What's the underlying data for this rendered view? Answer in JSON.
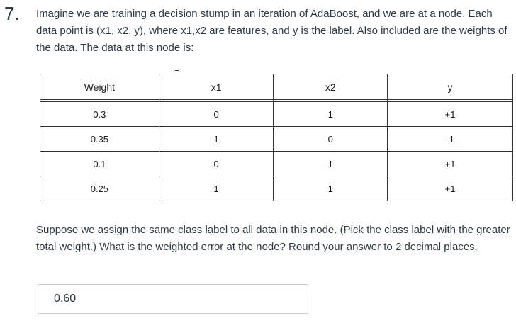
{
  "question": {
    "number": "7.",
    "prompt": "Imagine we are training a decision stump in an iteration of AdaBoost, and we are at a node. Each data point is (x1, x2, y), where x1,x2 are features, and y is the label. Also included are the weights of the data. The data at this node is:",
    "followup": "Suppose we assign the same class label to all data in this node. (Pick the class label with the greater total weight.) What is the weighted error at the node? Round your answer to 2 decimal places."
  },
  "table": {
    "headers": [
      "Weight",
      "x1",
      "x2",
      "y"
    ],
    "rows": [
      [
        "0.3",
        "0",
        "1",
        "+1"
      ],
      [
        "0.35",
        "1",
        "0",
        "-1"
      ],
      [
        "0.1",
        "0",
        "1",
        "+1"
      ],
      [
        "0.25",
        "1",
        "1",
        "+1"
      ]
    ]
  },
  "answer": {
    "value": "0.60"
  }
}
